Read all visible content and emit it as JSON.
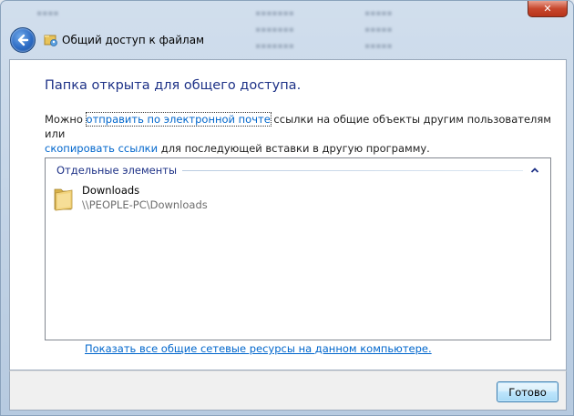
{
  "window": {
    "title": "Общий доступ к файлам",
    "close_glyph": "✕"
  },
  "content": {
    "heading": "Папка открыта для общего доступа.",
    "desc_prefix": "Можно ",
    "email_link": "отправить по электронной почте",
    "desc_middle": " ссылки на общие объекты другим пользователям или",
    "copy_link": "скопировать ссылки",
    "desc_suffix": " для последующей вставки в другую программу.",
    "group_title": "Отдельные элементы",
    "items": [
      {
        "name": "Downloads",
        "path": "\\\\PEOPLE-PC\\Downloads",
        "icon": "folder-icon"
      }
    ],
    "show_all_link": "Показать все общие сетевые ресурсы на данном компьютере."
  },
  "footer": {
    "done_label": "Готово"
  },
  "colors": {
    "heading": "#1e3287",
    "link": "#0066cc",
    "close_button": "#c7472d"
  }
}
